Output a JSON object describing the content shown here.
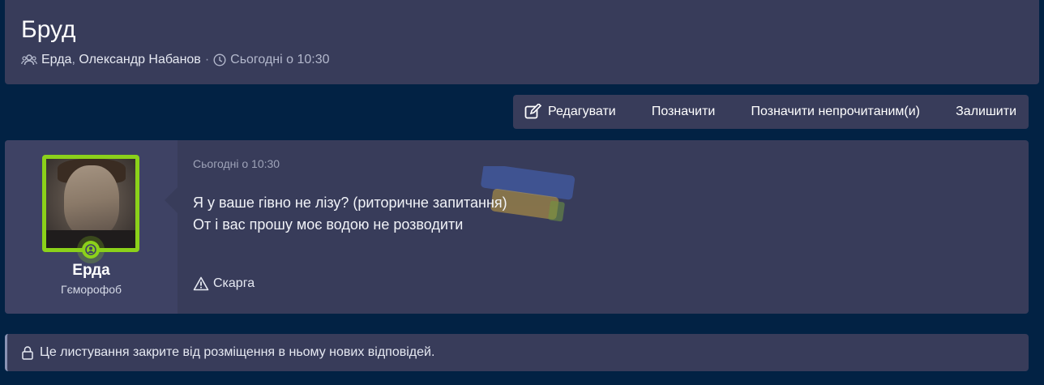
{
  "thread": {
    "title": "Бруд",
    "participants": [
      "Ерда",
      "Олександр Набанов"
    ],
    "participant_sep": ", ",
    "meta_sep": "·",
    "date": "Сьогодні о 10:30"
  },
  "actions": {
    "edit": "Редагувати",
    "mark": "Позначити",
    "mark_unread": "Позначити непрочитаним(и)",
    "leave": "Залишити"
  },
  "message": {
    "author": "Ерда",
    "author_title": "Гєморофоб",
    "date": "Сьогодні о 10:30",
    "lines": [
      "Я у ваше гівно не лізу? (риторичне запитання)",
      "От і вас прошу моє водою не розводити"
    ],
    "report_label": "Скарга"
  },
  "notice": {
    "text": "Це листування закрите від розміщення в ньому нових відповідей."
  },
  "colors": {
    "page_bg": "#022244",
    "block_bg": "#383c5a",
    "user_col_bg": "#3e4264",
    "online_green": "#8bd11a"
  },
  "icons": [
    "users-icon",
    "clock-icon",
    "edit-icon",
    "online-user-icon",
    "warning-icon",
    "lock-icon"
  ]
}
